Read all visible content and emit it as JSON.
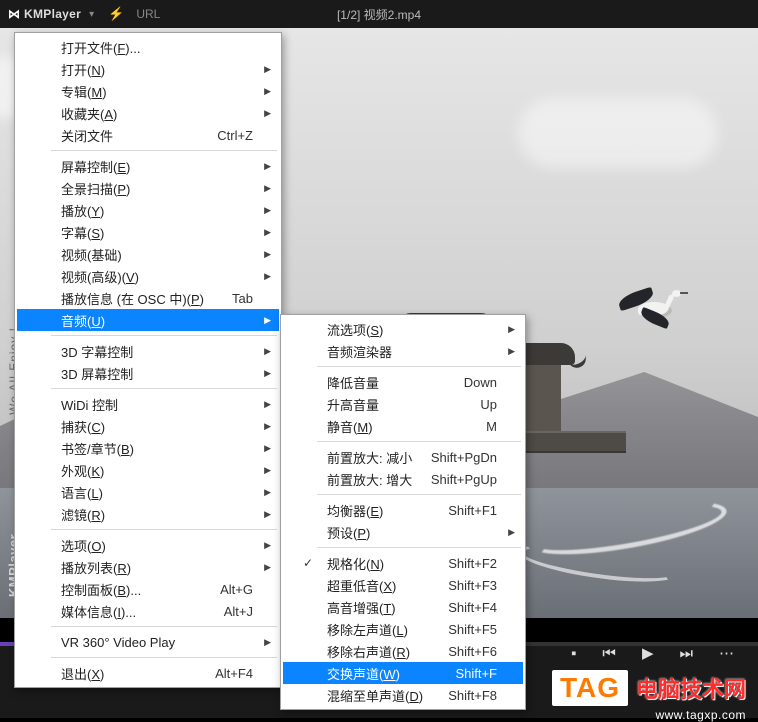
{
  "titlebar": {
    "app_name": "KMPlayer",
    "url_label": "URL",
    "center_title": "[1/2] 视频2.mp4"
  },
  "sidebar": {
    "tagline": "We All Enjoy !",
    "brand": "KMPlayer"
  },
  "menu": {
    "items": [
      {
        "label": "打开文件(F)...",
        "shortcut": "",
        "sub": false
      },
      {
        "label": "打开(N)",
        "shortcut": "",
        "sub": true
      },
      {
        "label": "专辑(M)",
        "shortcut": "",
        "sub": true
      },
      {
        "label": "收藏夹(A)",
        "shortcut": "",
        "sub": true
      },
      {
        "label": "关闭文件",
        "shortcut": "Ctrl+Z",
        "sub": false
      },
      {
        "sep": true
      },
      {
        "label": "屏幕控制(E)",
        "shortcut": "",
        "sub": true
      },
      {
        "label": "全景扫描(P)",
        "shortcut": "",
        "sub": true
      },
      {
        "label": "播放(Y)",
        "shortcut": "",
        "sub": true
      },
      {
        "label": "字幕(S)",
        "shortcut": "",
        "sub": true
      },
      {
        "label": "视频(基础)",
        "shortcut": "",
        "sub": true
      },
      {
        "label": "视频(高级)(V)",
        "shortcut": "",
        "sub": true
      },
      {
        "label": "播放信息 (在 OSC 中)(P)",
        "shortcut": "Tab",
        "sub": false
      },
      {
        "label": "音频(U)",
        "shortcut": "",
        "sub": true,
        "selected": true
      },
      {
        "sep": true
      },
      {
        "label": "3D 字幕控制",
        "shortcut": "",
        "sub": true
      },
      {
        "label": "3D 屏幕控制",
        "shortcut": "",
        "sub": true
      },
      {
        "sep": true
      },
      {
        "label": "WiDi 控制",
        "shortcut": "",
        "sub": true
      },
      {
        "label": "捕获(C)",
        "shortcut": "",
        "sub": true
      },
      {
        "label": "书签/章节(B)",
        "shortcut": "",
        "sub": true
      },
      {
        "label": "外观(K)",
        "shortcut": "",
        "sub": true
      },
      {
        "label": "语言(L)",
        "shortcut": "",
        "sub": true
      },
      {
        "label": "滤镜(R)",
        "shortcut": "",
        "sub": true
      },
      {
        "sep": true
      },
      {
        "label": "选项(O)",
        "shortcut": "",
        "sub": true
      },
      {
        "label": "播放列表(R)",
        "shortcut": "",
        "sub": true
      },
      {
        "label": "控制面板(B)...",
        "shortcut": "Alt+G",
        "sub": false
      },
      {
        "label": "媒体信息(I)...",
        "shortcut": "Alt+J",
        "sub": false
      },
      {
        "sep": true
      },
      {
        "label": "VR 360° Video Play",
        "shortcut": "",
        "sub": true
      },
      {
        "sep": true
      },
      {
        "label": "退出(X)",
        "shortcut": "Alt+F4",
        "sub": false
      }
    ]
  },
  "submenu": {
    "items": [
      {
        "label": "流选项(S)",
        "shortcut": "",
        "sub": true
      },
      {
        "label": "音频渲染器",
        "shortcut": "",
        "sub": true
      },
      {
        "sep": true
      },
      {
        "label": "降低音量",
        "shortcut": "Down",
        "sub": false
      },
      {
        "label": "升高音量",
        "shortcut": "Up",
        "sub": false
      },
      {
        "label": "静音(M)",
        "shortcut": "M",
        "sub": false
      },
      {
        "sep": true
      },
      {
        "label": "前置放大: 减小",
        "shortcut": "Shift+PgDn",
        "sub": false
      },
      {
        "label": "前置放大: 增大",
        "shortcut": "Shift+PgUp",
        "sub": false
      },
      {
        "sep": true
      },
      {
        "label": "均衡器(E)",
        "shortcut": "Shift+F1",
        "sub": false
      },
      {
        "label": "预设(P)",
        "shortcut": "",
        "sub": true
      },
      {
        "sep": true
      },
      {
        "label": "规格化(N)",
        "shortcut": "Shift+F2",
        "sub": false,
        "checked": true
      },
      {
        "label": "超重低音(X)",
        "shortcut": "Shift+F3",
        "sub": false
      },
      {
        "label": "高音增强(T)",
        "shortcut": "Shift+F4",
        "sub": false
      },
      {
        "label": "移除左声道(L)",
        "shortcut": "Shift+F5",
        "sub": false
      },
      {
        "label": "移除右声道(R)",
        "shortcut": "Shift+F6",
        "sub": false
      },
      {
        "label": "交换声道(W)",
        "shortcut": "Shift+F",
        "sub": false,
        "selected": true
      },
      {
        "label": "混缩至单声道(D)",
        "shortcut": "Shift+F8",
        "sub": false
      }
    ]
  },
  "watermark": {
    "tag": "TAG",
    "cn": "电脑技术网",
    "url": "www.tagxp.com"
  }
}
